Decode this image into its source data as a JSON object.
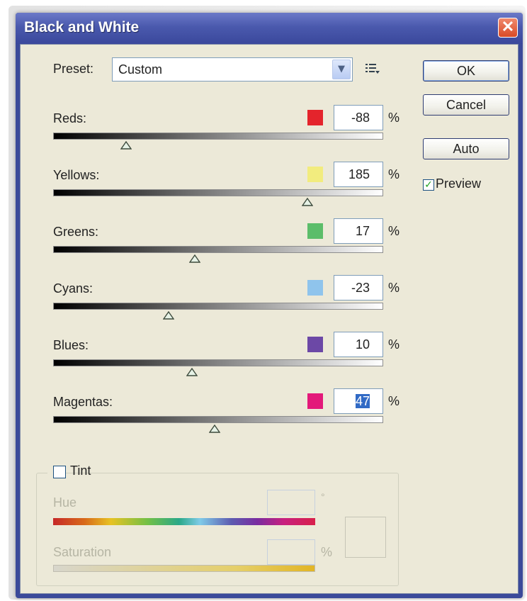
{
  "window": {
    "title": "Black and White",
    "close_glyph": "✕"
  },
  "preset": {
    "label": "Preset:",
    "value": "Custom",
    "dropdown_icon": "chevron-down-icon",
    "menu_icon": "preset-options-icon"
  },
  "buttons": {
    "ok": "OK",
    "cancel": "Cancel",
    "auto": "Auto"
  },
  "preview": {
    "label": "Preview",
    "checked": true
  },
  "percent_symbol": "%",
  "channels": [
    {
      "label": "Reds:",
      "value": "-88",
      "color": "#e4242c",
      "slider_fraction": 0.22
    },
    {
      "label": "Yellows:",
      "value": "185",
      "color": "#f2ec7e",
      "slider_fraction": 0.77
    },
    {
      "label": "Greens:",
      "value": "17",
      "color": "#5cbd6a",
      "slider_fraction": 0.43
    },
    {
      "label": "Cyans:",
      "value": "-23",
      "color": "#8fc4ec",
      "slider_fraction": 0.35
    },
    {
      "label": "Blues:",
      "value": "10",
      "color": "#6c48a6",
      "slider_fraction": 0.42
    },
    {
      "label": "Magentas:",
      "value": "47",
      "color": "#e3197a",
      "slider_fraction": 0.49,
      "selected": true
    }
  ],
  "tint": {
    "label": "Tint",
    "checked": false,
    "hue_label": "Hue",
    "hue_unit": "°",
    "saturation_label": "Saturation",
    "saturation_unit": "%"
  }
}
